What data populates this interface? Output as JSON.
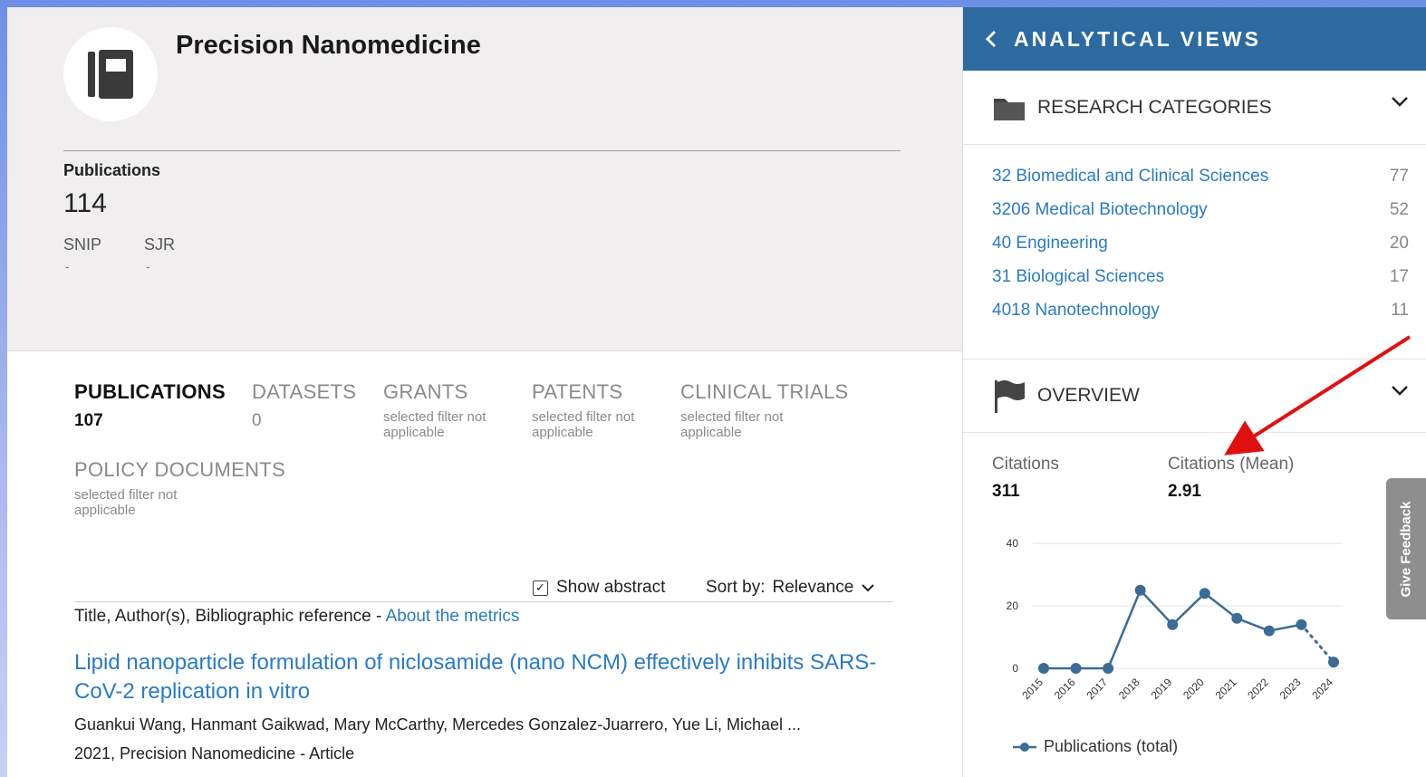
{
  "journal": {
    "title": "Precision Nanomedicine",
    "publications_label": "Publications",
    "publications_count": "114",
    "metrics": [
      {
        "label": "SNIP",
        "value": "-"
      },
      {
        "label": "SJR",
        "value": "-"
      }
    ]
  },
  "tabs": [
    {
      "label": "PUBLICATIONS",
      "count": "107",
      "note": "",
      "active": true
    },
    {
      "label": "DATASETS",
      "count": "0",
      "note": ""
    },
    {
      "label": "GRANTS",
      "count": "",
      "note": "selected filter not applicable"
    },
    {
      "label": "PATENTS",
      "count": "",
      "note": "selected filter not applicable"
    },
    {
      "label": "CLINICAL TRIALS",
      "count": "",
      "note": "selected filter not applicable"
    },
    {
      "label": "POLICY DOCUMENTS",
      "count": "",
      "note": "selected filter not applicable"
    }
  ],
  "controls": {
    "show_abstract_label": "Show abstract",
    "show_abstract_checked": true,
    "sort_label": "Sort by:",
    "sort_value": "Relevance"
  },
  "reference_line": {
    "text": "Title, Author(s), Bibliographic reference - ",
    "link": "About the metrics"
  },
  "result": {
    "title": "Lipid nanoparticle formulation of niclosamide (nano NCM) effectively inhibits SARS-CoV-2 replication in vitro",
    "authors": "Guankui Wang, Hanmant Gaikwad, Mary McCarthy, Mercedes Gonzalez-Juarrero, Yue Li, Michael ...",
    "meta": "2021, Precision Nanomedicine - Article"
  },
  "panel": {
    "title": "ANALYTICAL VIEWS",
    "research_categories_label": "RESEARCH CATEGORIES",
    "categories": [
      {
        "name": "32 Biomedical and Clinical Sciences",
        "count": "77"
      },
      {
        "name": "3206 Medical Biotechnology",
        "count": "52"
      },
      {
        "name": "40 Engineering",
        "count": "20"
      },
      {
        "name": "31 Biological Sciences",
        "count": "17"
      },
      {
        "name": "4018 Nanotechnology",
        "count": "11"
      }
    ],
    "overview_label": "OVERVIEW",
    "citations_label": "Citations",
    "citations_value": "311",
    "citations_mean_label": "Citations (Mean)",
    "citations_mean_value": "2.91",
    "feedback_label": "Give Feedback"
  },
  "colors": {
    "accent": "#2c6aa0",
    "link": "#2a7bc4",
    "line": "#3b6c96",
    "annotation_arrow": "#e01010"
  },
  "chart_data": {
    "type": "line",
    "x": [
      "2015",
      "2016",
      "2017",
      "2018",
      "2019",
      "2020",
      "2021",
      "2022",
      "2023",
      "2024"
    ],
    "series": [
      {
        "name": "Publications (total)",
        "values": [
          0,
          0,
          0,
          25,
          14,
          24,
          16,
          12,
          14,
          2
        ],
        "dotted_from_index": 8
      }
    ],
    "yticks": [
      0,
      20,
      40
    ],
    "ylim": [
      0,
      40
    ],
    "grid": true,
    "legend": "bottom"
  }
}
